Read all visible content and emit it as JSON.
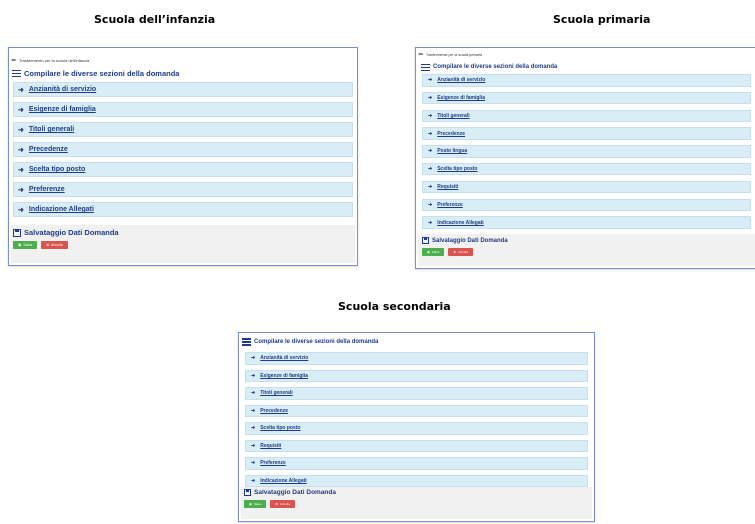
{
  "headings": {
    "infanzia": "Scuola dell’infanzia",
    "primaria": "Scuola primaria",
    "secondaria": "Scuola secondaria"
  },
  "infanzia": {
    "breadcrumb": "Trasferimento per la scuola dell'infanzia",
    "section_title": "Compilare le diverse sezioni della domanda",
    "sections": [
      "Anzianità di servizio",
      "Esigenze di famiglia",
      "Titoli generali",
      "Precedenze",
      "Scelta tipo posto",
      "Preferenze",
      "Indicazione Allegati"
    ],
    "save_title": "Salvataggio Dati Domanda",
    "save_label": "Salva",
    "cancel_label": "Annulla"
  },
  "primaria": {
    "breadcrumb": "Trasferimento per la scuola primaria",
    "section_title": "Compilare le diverse sezioni della domanda",
    "sections": [
      "Anzianità di servizio",
      "Esigenze di famiglia",
      "Titoli generali",
      "Precedenze",
      "Posto lingua",
      "Scelta tipo posto",
      "Requisiti",
      "Preferenze",
      "Indicazione Allegati"
    ],
    "save_title": "Salvataggio Dati Domanda",
    "save_label": "Salva",
    "cancel_label": "Annulla"
  },
  "secondaria": {
    "section_title": "Compilare le diverse sezioni della domanda",
    "sections": [
      "Anzianità di servizio",
      "Esigenze di famiglia",
      "Titoli generali",
      "Precedenze",
      "Scelta tipo posto",
      "Requisiti",
      "Preferenze",
      "Indicazione Allegati"
    ],
    "save_title": "Salvataggio Dati Domanda",
    "save_label": "Salva",
    "cancel_label": "Annulla"
  },
  "icons": {
    "breadcrumb": "pencil-icon",
    "section_title": "list-icon",
    "section_row": "arrow-right-icon",
    "save_title": "floppy-disk-icon",
    "save_button": "floppy-disk-icon",
    "cancel_button": "remove-icon"
  },
  "colors": {
    "accent": "#1f3c88",
    "row_background": "#d9edf7",
    "save_button": "#4cae4c",
    "cancel_button": "#d9534f"
  }
}
